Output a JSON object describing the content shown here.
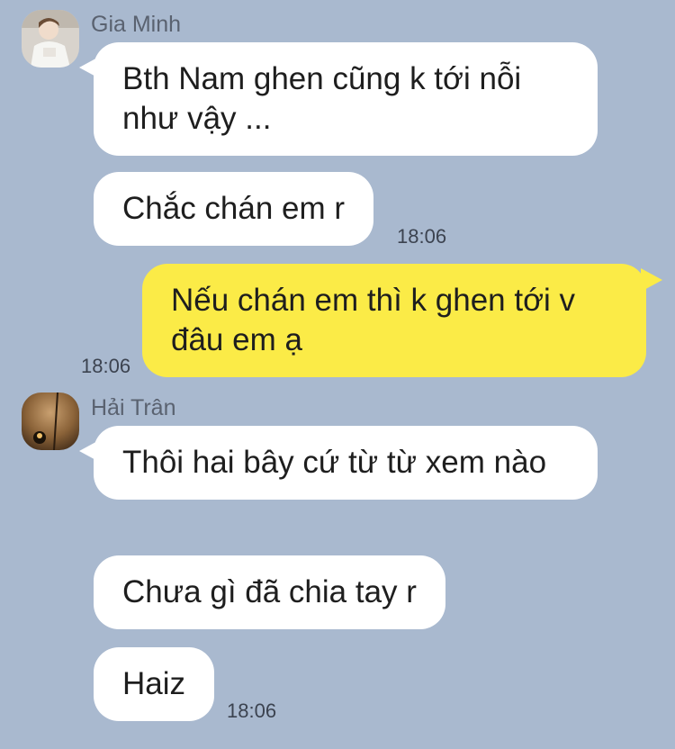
{
  "groups": [
    {
      "sender": "Gia Minh",
      "avatar": "person-photo",
      "messages": [
        {
          "text": "Bth Nam ghen cũng k tới nỗi như vậy ..."
        },
        {
          "text": "Chắc chán em r",
          "time": "18:06"
        }
      ]
    },
    {
      "sender": "me",
      "messages": [
        {
          "text": "Nếu chán em thì k ghen tới v đâu em ạ",
          "time": "18:06"
        }
      ]
    },
    {
      "sender": "Hải Trân",
      "avatar": "lamp-photo",
      "messages": [
        {
          "text": "Thôi hai bây cứ từ từ xem nào"
        },
        {
          "text": "Chưa gì đã chia tay r"
        },
        {
          "text": "Haiz",
          "time": "18:06"
        }
      ]
    }
  ],
  "colors": {
    "background": "#a9b9cf",
    "incoming_bubble": "#ffffff",
    "outgoing_bubble": "#fbeb47"
  }
}
